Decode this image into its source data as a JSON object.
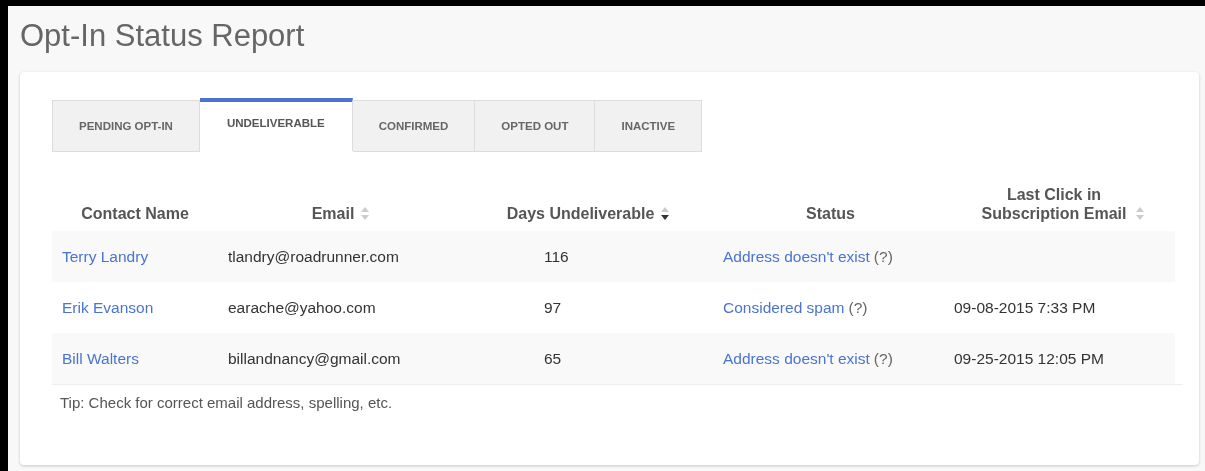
{
  "title": "Opt-In Status Report",
  "tabs": [
    {
      "label": "PENDING OPT-IN",
      "selected": false
    },
    {
      "label": "UNDELIVERABLE",
      "selected": true
    },
    {
      "label": "CONFIRMED",
      "selected": false
    },
    {
      "label": "OPTED OUT",
      "selected": false
    },
    {
      "label": "INACTIVE",
      "selected": false
    }
  ],
  "table": {
    "columns": [
      {
        "label": "Contact Name"
      },
      {
        "label": "Email",
        "sorted": false
      },
      {
        "label": "Days Undeliverable",
        "sorted": true
      },
      {
        "label": "Status"
      },
      {
        "label": "Last Click in Subscription Email",
        "sorted": false
      }
    ],
    "rows": [
      {
        "name": "Terry Landry",
        "email": "tlandry@roadrunner.com",
        "days": "116",
        "status": {
          "text": "Address doesn't exist",
          "help": "(?)"
        }
      },
      {
        "name": "Erik Evanson",
        "email": "earache@yahoo.com",
        "days": "97",
        "status": {
          "text": "Considered spam",
          "help": "(?)"
        },
        "last_click": "09-08-2015 7:33 PM"
      },
      {
        "name": "Bill Walters",
        "email": "billandnancy@gmail.com",
        "days": "65",
        "status": {
          "text": "Address doesn't exist",
          "help": "(?)"
        },
        "last_click": "09-25-2015 12:05 PM"
      }
    ]
  },
  "tip": "Tip: Check for correct email address, spelling, etc."
}
